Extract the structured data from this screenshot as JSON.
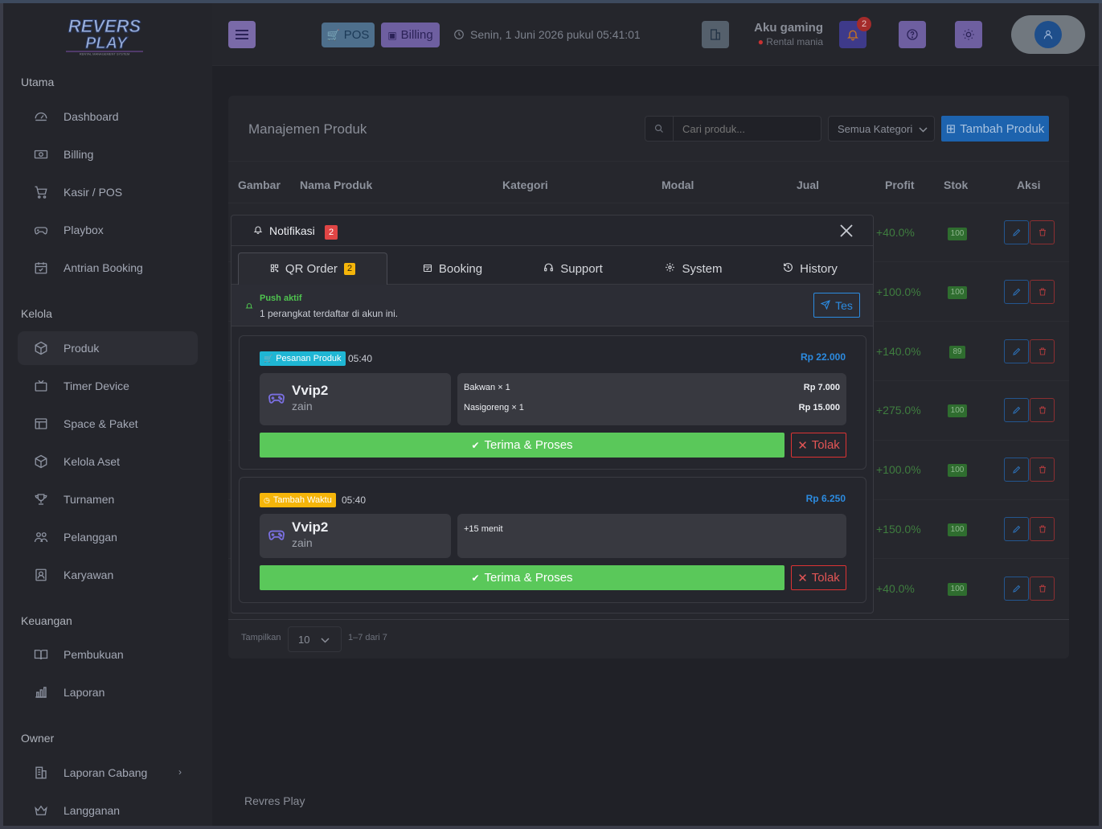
{
  "header": {
    "pos": "POS",
    "billing": "Billing",
    "datetime": "Senin, 1 Juni 2026 pukul 05:41:01",
    "user_name": "Aku gaming",
    "user_branch": "Rental mania",
    "notif_count": "2"
  },
  "sidebar": {
    "logo_line1": "REVERS",
    "logo_line2": "PLAY",
    "logo_tagline": "RENTAL MANAGEMENT SYSTEM",
    "sec_utama": "Utama",
    "sec_kelola": "Kelola",
    "sec_keuangan": "Keuangan",
    "sec_owner": "Owner",
    "items": [
      {
        "label": "Dashboard",
        "icon": "gauge-icon"
      },
      {
        "label": "Billing",
        "icon": "cash-icon"
      },
      {
        "label": "Kasir / POS",
        "icon": "cart-icon"
      },
      {
        "label": "Playbox",
        "icon": "gamepad-icon"
      },
      {
        "label": "Antrian Booking",
        "icon": "calendar-check-icon"
      },
      {
        "label": "Produk",
        "icon": "box-icon"
      },
      {
        "label": "Timer Device",
        "icon": "tv-icon"
      },
      {
        "label": "Space & Paket",
        "icon": "layout-icon"
      },
      {
        "label": "Kelola Aset",
        "icon": "cube-icon"
      },
      {
        "label": "Turnamen",
        "icon": "trophy-icon"
      },
      {
        "label": "Pelanggan",
        "icon": "users-icon"
      },
      {
        "label": "Karyawan",
        "icon": "badge-icon"
      },
      {
        "label": "Pembukuan",
        "icon": "book-icon"
      },
      {
        "label": "Laporan",
        "icon": "chart-icon"
      },
      {
        "label": "Laporan Cabang",
        "icon": "building-icon"
      },
      {
        "label": "Langganan",
        "icon": "crown-icon"
      }
    ]
  },
  "page": {
    "title": "Manajemen Produk",
    "search_placeholder": "Cari produk...",
    "category_select": "Semua Kategori",
    "add_button": "Tambah Produk",
    "footer": "Revres Play"
  },
  "table": {
    "headers": [
      "Gambar",
      "Nama Produk",
      "Kategori",
      "Modal",
      "Jual",
      "Profit",
      "Stok",
      "Aksi"
    ],
    "rows": [
      {
        "profit": "+40.0%",
        "stok": "100"
      },
      {
        "profit": "+100.0%",
        "stok": "100"
      },
      {
        "profit": "+140.0%",
        "stok": "89"
      },
      {
        "profit": "+275.0%",
        "stok": "100"
      },
      {
        "profit": "+100.0%",
        "stok": "100"
      },
      {
        "profit": "+150.0%",
        "stok": "100"
      },
      {
        "profit": "+40.0%",
        "stok": "100"
      }
    ],
    "show_label": "Tampilkan",
    "page_size": "10",
    "range": "1–7 dari 7"
  },
  "modal": {
    "title": "Notifikasi",
    "count": "2",
    "tabs": [
      {
        "label": "QR Order",
        "badge": "2"
      },
      {
        "label": "Booking"
      },
      {
        "label": "Support"
      },
      {
        "label": "System"
      },
      {
        "label": "History"
      }
    ],
    "push_title": "Push aktif",
    "push_desc": "1 perangkat terdaftar di akun ini.",
    "test_button": "Tes",
    "orders": [
      {
        "type": "Pesanan Produk",
        "time": "05:40",
        "total": "Rp 22.000",
        "device": "Vvip2",
        "customer": "zain",
        "items": [
          {
            "name": "Bakwan × 1",
            "price": "Rp 7.000"
          },
          {
            "name": "Nasigoreng × 1",
            "price": "Rp 15.000"
          }
        ],
        "accept": "Terima & Proses",
        "reject": "Tolak"
      },
      {
        "type": "Tambah Waktu",
        "time": "05:40",
        "total": "Rp 6.250",
        "device": "Vvip2",
        "customer": "zain",
        "note": "+15 menit",
        "accept": "Terima & Proses",
        "reject": "Tolak"
      }
    ]
  },
  "colors": {
    "accent": "#2c8be0",
    "success": "#5ac85a",
    "danger": "#e25555",
    "badge_product": "#1fb6d4",
    "badge_time": "#f5b50a"
  }
}
